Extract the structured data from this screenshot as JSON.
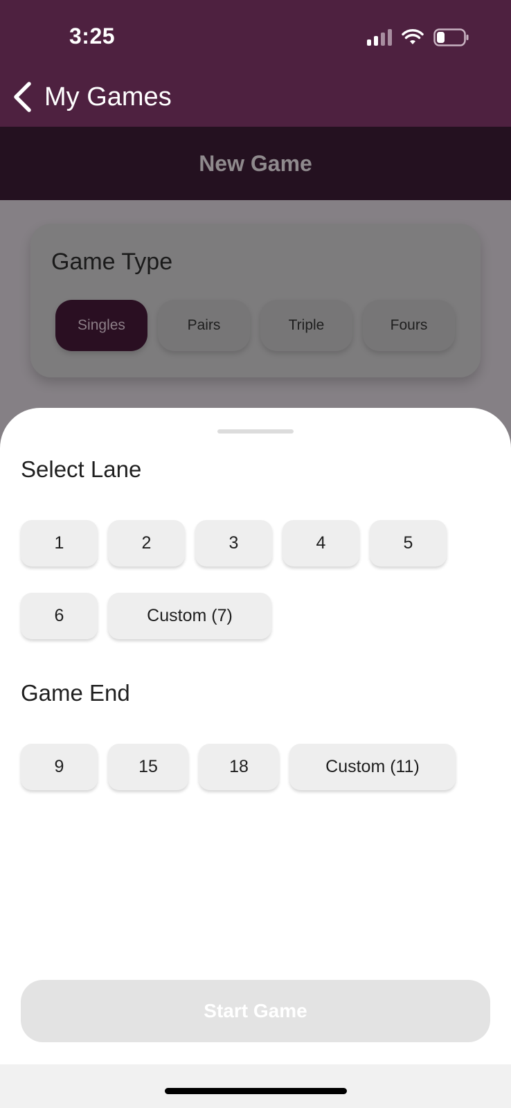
{
  "status_bar": {
    "time": "3:25",
    "icons": [
      "cellular-signal-icon",
      "wifi-icon",
      "battery-low-icon"
    ]
  },
  "nav": {
    "back_label": "My Games",
    "back_icon": "chevron-left-icon"
  },
  "header": {
    "title": "New Game"
  },
  "game_type": {
    "title": "Game Type",
    "options": [
      {
        "label": "Singles",
        "selected": true
      },
      {
        "label": "Pairs",
        "selected": false
      },
      {
        "label": "Triple",
        "selected": false
      },
      {
        "label": "Fours",
        "selected": false
      }
    ]
  },
  "sheet": {
    "select_lane": {
      "title": "Select Lane",
      "row1": [
        "1",
        "2",
        "3",
        "4",
        "5"
      ],
      "row2": [
        "6",
        "Custom (7)"
      ]
    },
    "game_end": {
      "title": "Game End",
      "options": [
        "9",
        "15",
        "18",
        "Custom (11)"
      ]
    },
    "start_label": "Start Game"
  },
  "colors": {
    "brand": "#4e2140",
    "header_band": "#241120",
    "selected_chip": "#2a0f22",
    "chip_bg": "#eeeeee",
    "start_disabled": "#e3e3e3"
  }
}
